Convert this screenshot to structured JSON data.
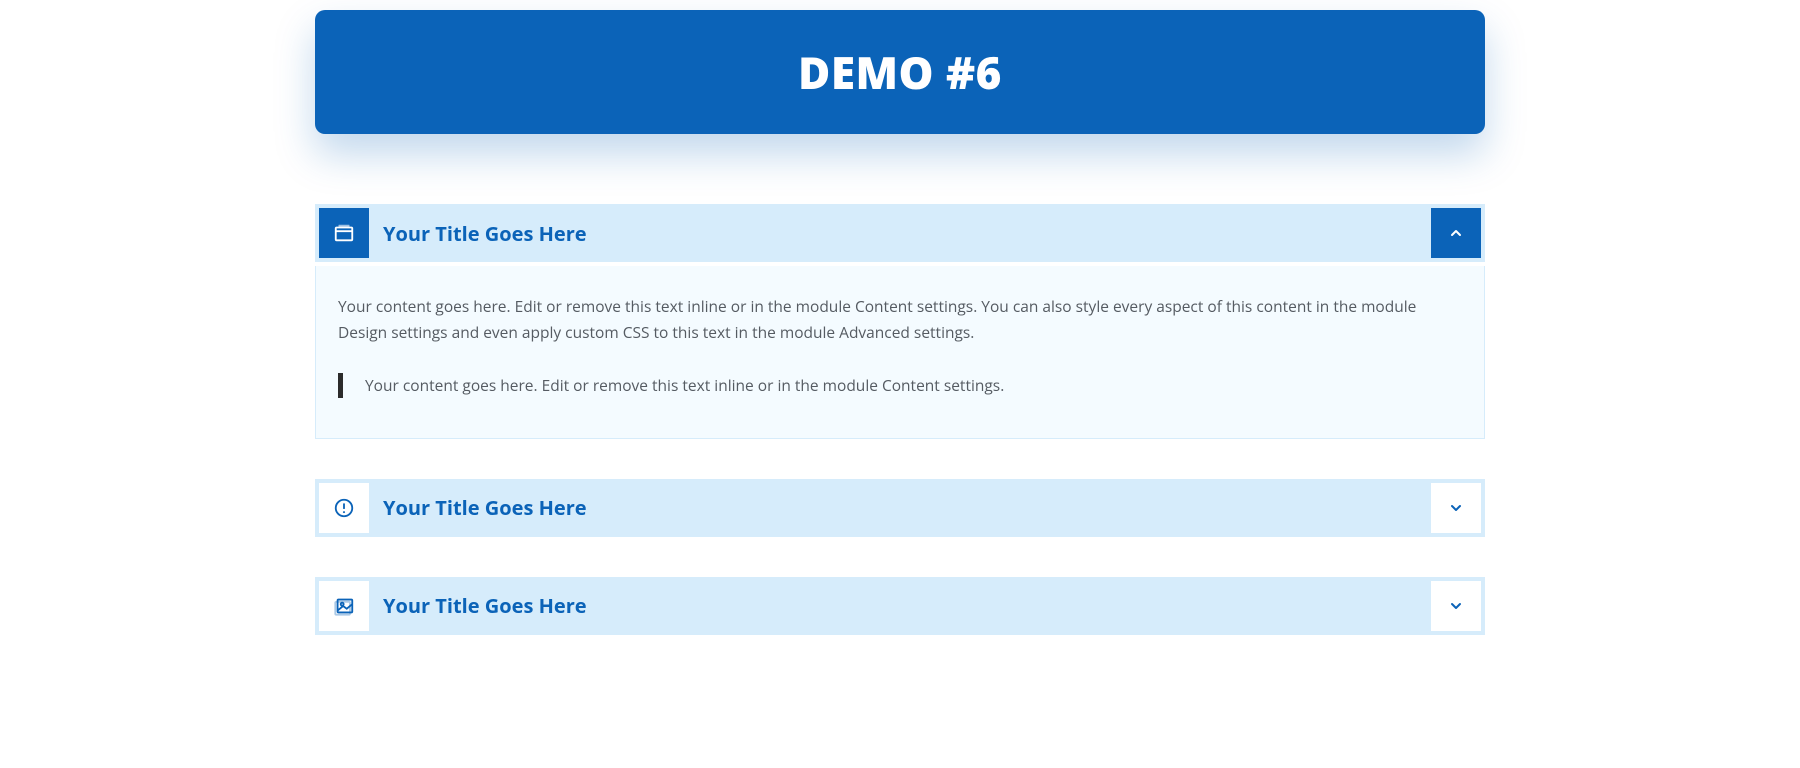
{
  "banner": {
    "title": "DEMO #6"
  },
  "accordion": [
    {
      "icon": "window-icon",
      "title": "Your Title Goes Here",
      "expanded": true,
      "body": "Your content goes here. Edit or remove this text inline or in the module Content settings. You can also style every aspect of this content in the module Design settings and even apply custom CSS to this text in the module Advanced settings.",
      "quote": "Your content goes here. Edit or remove this text inline or in the module Content settings."
    },
    {
      "icon": "alert-icon",
      "title": "Your Title Goes Here",
      "expanded": false
    },
    {
      "icon": "image-icon",
      "title": "Your Title Goes Here",
      "expanded": false
    }
  ]
}
